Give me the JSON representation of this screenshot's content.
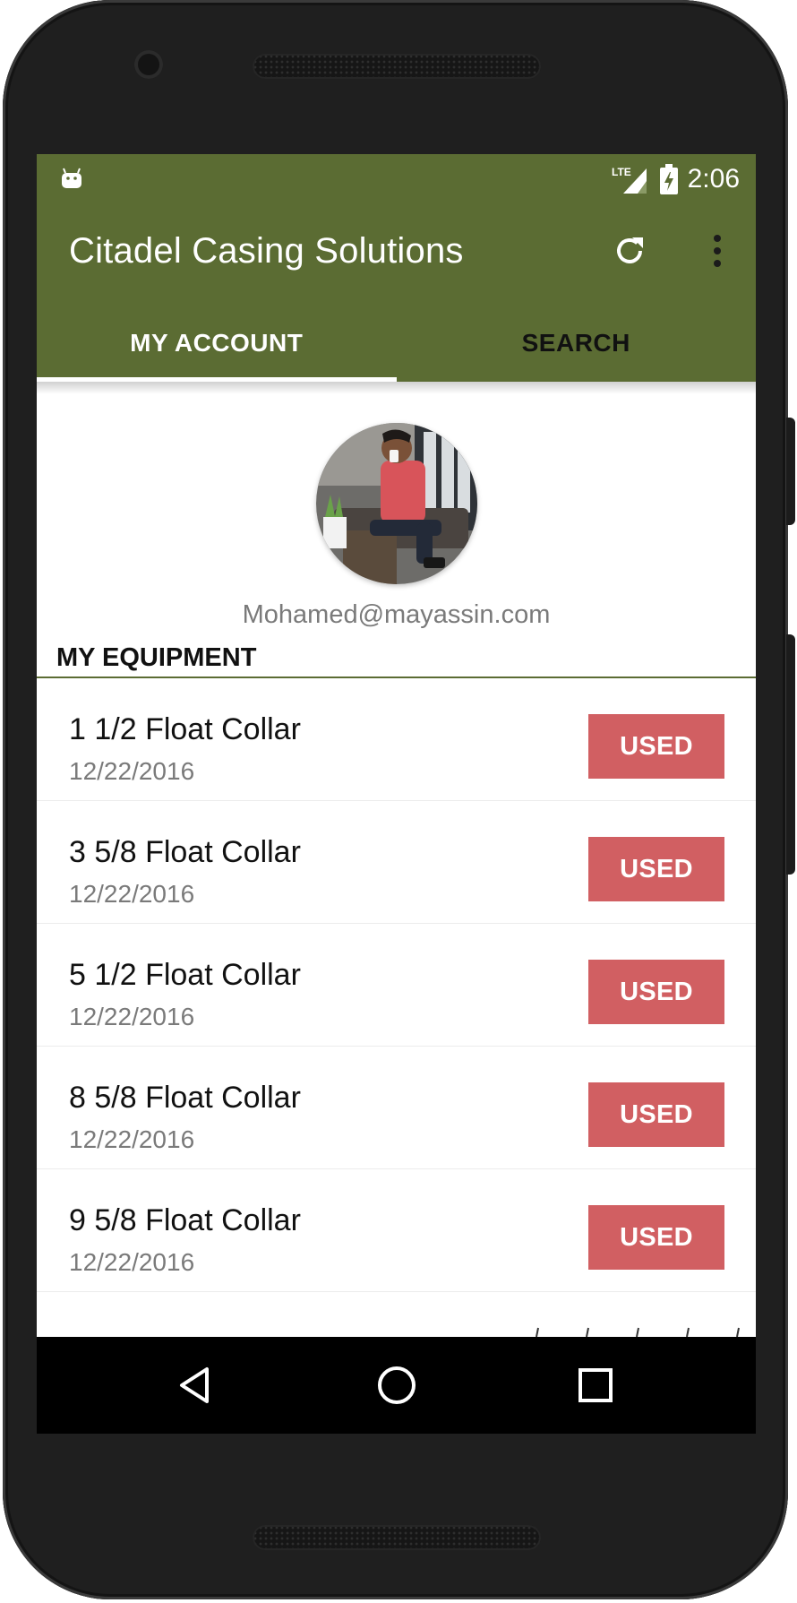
{
  "statusbar": {
    "time": "2:06",
    "network_label": "LTE"
  },
  "toolbar": {
    "title": "Citadel Casing Solutions",
    "refresh_icon": "refresh-icon",
    "menu_icon": "more-vert-icon"
  },
  "tabs": [
    {
      "label": "MY ACCOUNT",
      "active": true
    },
    {
      "label": "SEARCH",
      "active": false
    }
  ],
  "profile": {
    "email": "Mohamed@mayassin.com"
  },
  "section": {
    "title": "MY EQUIPMENT"
  },
  "equipment": [
    {
      "name": "1 1/2 Float Collar",
      "date": "12/22/2016",
      "status": "USED"
    },
    {
      "name": "3 5/8 Float Collar",
      "date": "12/22/2016",
      "status": "USED"
    },
    {
      "name": "5 1/2 Float Collar",
      "date": "12/22/2016",
      "status": "USED"
    },
    {
      "name": "8 5/8 Float Collar",
      "date": "12/22/2016",
      "status": "USED"
    },
    {
      "name": "9 5/8 Float Collar",
      "date": "12/22/2016",
      "status": "USED"
    }
  ],
  "colors": {
    "primary": "#5b6c33",
    "used_button": "#d15f62"
  },
  "navbar": {
    "icons": [
      "back-icon",
      "home-icon",
      "recents-icon"
    ]
  }
}
